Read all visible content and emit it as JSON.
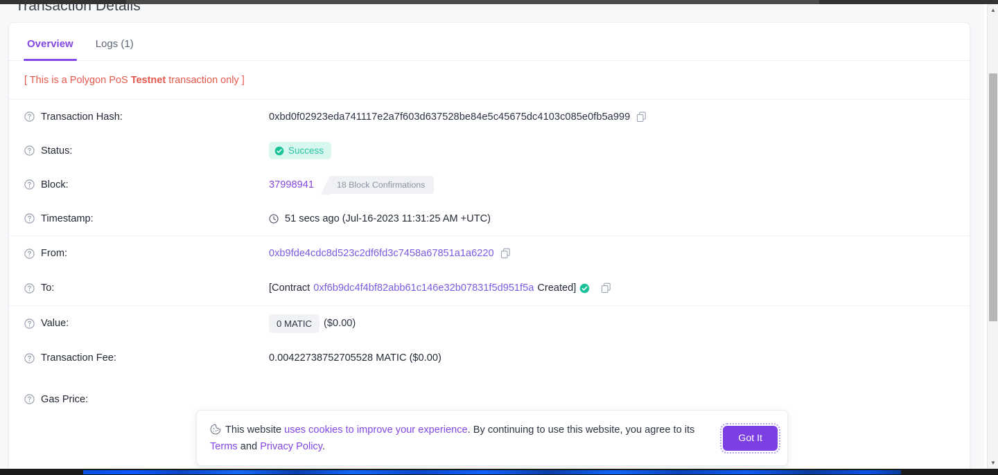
{
  "page": {
    "title": "Transaction Details"
  },
  "tabs": [
    {
      "label": "Overview",
      "active": true
    },
    {
      "label": "Logs (1)",
      "active": false
    }
  ],
  "notice": {
    "prefix": "[ This is a Polygon PoS ",
    "emphasis": "Testnet",
    "suffix": " transaction only ]"
  },
  "details": {
    "transaction_hash": {
      "label": "Transaction Hash:",
      "value": "0xbd0f02923eda741117e2a7f603d637528be84e5c45675dc4103c085e0fb5a999",
      "copy_icon": "copy-icon",
      "help_icon": "question-circle-icon"
    },
    "status": {
      "label": "Status:",
      "value": "Success",
      "badge_color": "#d8f7ef",
      "badge_text_color": "#28c3a3",
      "check_icon": "check-circle-icon"
    },
    "block": {
      "label": "Block:",
      "number": "37998941",
      "confirmations": "18 Block Confirmations"
    },
    "timestamp": {
      "label": "Timestamp:",
      "value": "51 secs ago (Jul-16-2023 11:31:25 AM +UTC)",
      "clock_icon": "clock-icon"
    },
    "from": {
      "label": "From:",
      "address": "0xb9fde4cdc8d523c2df6fd3c7458a67851a1a6220",
      "copy_icon": "copy-icon"
    },
    "to": {
      "label": "To:",
      "prefix": "[Contract",
      "address": "0xf6b9dc4f4bf82abb61c146e32b07831f5d951f5a",
      "suffix": "Created]",
      "verified_icon": "check-circle-icon",
      "copy_icon": "copy-icon"
    },
    "value": {
      "label": "Value:",
      "amount": "0 MATIC",
      "usd": "($0.00)"
    },
    "transaction_fee": {
      "label": "Transaction Fee:",
      "value": "0.00422738752705528 MATIC ($0.00)"
    },
    "gas_price": {
      "label": "Gas Price:",
      "value": ""
    }
  },
  "cookie_banner": {
    "icon": "cookie-icon",
    "text_1": "This website ",
    "link_1": "uses cookies to improve your experience",
    "text_2": ". By continuing to use this website, you agree to its ",
    "link_2": "Terms",
    "text_3": " and ",
    "link_3": "Privacy Policy",
    "text_4": ".",
    "button_label": "Got It",
    "button_color": "#7b3fe4"
  },
  "scrollbar": {
    "up_arrow": "▲",
    "down_arrow": "▼"
  },
  "colors": {
    "accent": "#8247e5",
    "warning": "#e4584b",
    "success": "#17c299"
  }
}
